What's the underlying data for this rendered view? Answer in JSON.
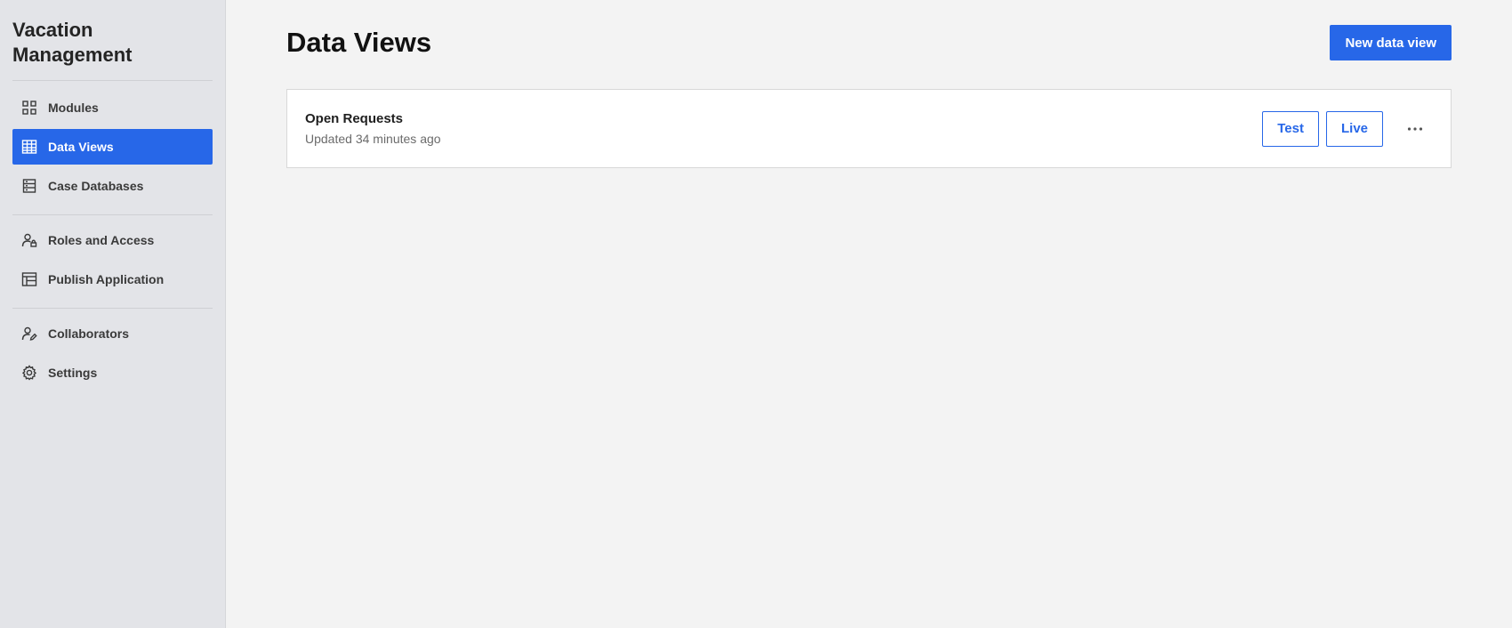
{
  "sidebar": {
    "app_title": "Vacation Management",
    "groups": [
      [
        {
          "label": "Modules",
          "icon": "grid-icon"
        },
        {
          "label": "Data Views",
          "icon": "table-icon",
          "active": true
        },
        {
          "label": "Case Databases",
          "icon": "database-icon"
        }
      ],
      [
        {
          "label": "Roles and Access",
          "icon": "user-lock-icon"
        },
        {
          "label": "Publish Application",
          "icon": "layout-icon"
        }
      ],
      [
        {
          "label": "Collaborators",
          "icon": "user-edit-icon"
        },
        {
          "label": "Settings",
          "icon": "gear-icon"
        }
      ]
    ]
  },
  "header": {
    "title": "Data Views",
    "new_button_label": "New data view"
  },
  "data_views": [
    {
      "name": "Open Requests",
      "updated": "Updated 34 minutes ago",
      "test_label": "Test",
      "live_label": "Live",
      "more_icon": "ellipsis-icon"
    }
  ],
  "colors": {
    "accent": "#2767e8",
    "sidebar_bg": "#e3e4e8",
    "page_bg": "#f3f3f3"
  }
}
